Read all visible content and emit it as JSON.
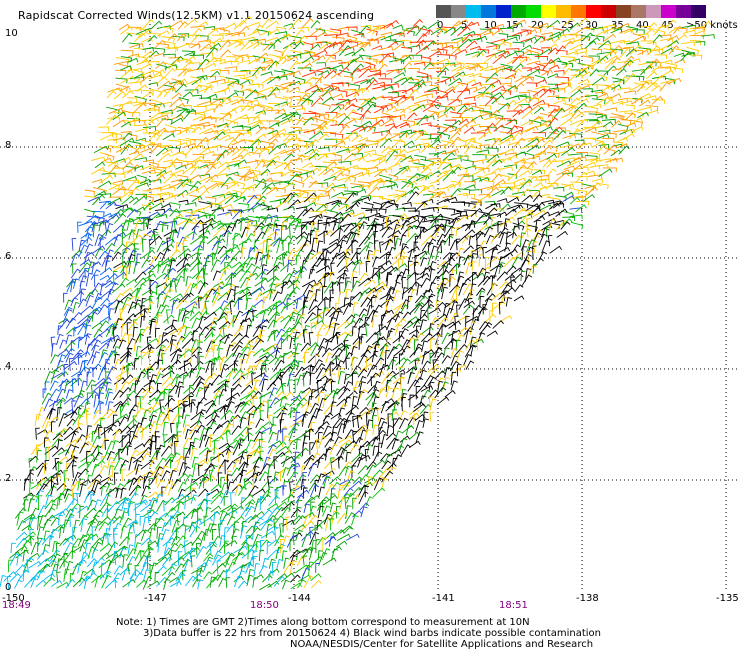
{
  "title": "Rapidscat Corrected Winds(12.5KM) v1.1 20150624 ascending",
  "legend": {
    "colors": [
      "#555555",
      "#888888",
      "#00bbee",
      "#0077dd",
      "#0022cc",
      "#00aa00",
      "#00dd00",
      "#ffff00",
      "#ffbb00",
      "#ff7700",
      "#ff0000",
      "#cc0000",
      "#884422",
      "#aa7766",
      "#cc99bb",
      "#cc00cc",
      "#770099",
      "#330066"
    ],
    "labels": [
      "0",
      "5",
      "10",
      "15",
      "20",
      "25",
      "30",
      "35",
      "40",
      "45",
      ">50 knots"
    ]
  },
  "axes": {
    "lat_labels": [
      "10",
      "8",
      "6",
      "4",
      "2",
      "0"
    ],
    "lon_labels": [
      "-150",
      "-147",
      "-144",
      "-141",
      "-138",
      "-135"
    ],
    "time_labels": [
      "18:49",
      "18:50",
      "18:51"
    ]
  },
  "notes": {
    "line1": "Note: 1) Times are GMT 2)Times along bottom correspond to measurement at 10N",
    "line2": "3)Data buffer is 22 hrs from 20150624 4) Black wind barbs indicate possible contamination",
    "line3": "NOAA/NESDIS/Center for Satellite Applications and Research"
  }
}
